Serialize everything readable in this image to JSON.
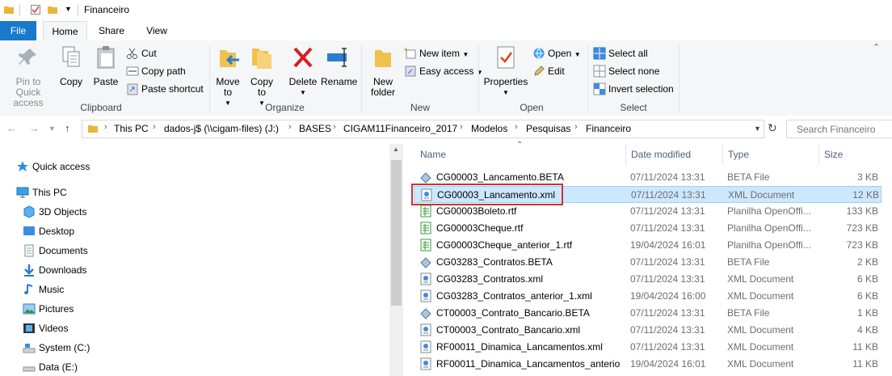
{
  "window": {
    "title": "Financeiro"
  },
  "tabs": [
    {
      "label": "File"
    },
    {
      "label": "Home"
    },
    {
      "label": "Share"
    },
    {
      "label": "View"
    }
  ],
  "ribbon": {
    "clipboard": {
      "label": "Clipboard",
      "pin": "Pin to Quick access",
      "copy": "Copy",
      "paste": "Paste",
      "cut": "Cut",
      "copy_path": "Copy path",
      "paste_shortcut": "Paste shortcut"
    },
    "organize": {
      "label": "Organize",
      "move_to": "Move to",
      "copy_to": "Copy to",
      "delete": "Delete",
      "rename": "Rename"
    },
    "new": {
      "label": "New",
      "new_folder": "New folder",
      "new_item": "New item",
      "easy_access": "Easy access"
    },
    "open": {
      "label": "Open",
      "properties": "Properties",
      "open": "Open",
      "edit": "Edit"
    },
    "select": {
      "label": "Select",
      "select_all": "Select all",
      "select_none": "Select none",
      "invert": "Invert selection"
    }
  },
  "address": {
    "crumbs": [
      "This PC",
      "dados-j$ (\\\\cigam-files) (J:)",
      "BASES",
      "CIGAM11Financeiro_2017",
      "Modelos",
      "Pesquisas",
      "Financeiro"
    ],
    "search_placeholder": "Search Financeiro"
  },
  "nav": {
    "quick_access": "Quick access",
    "this_pc": "This PC",
    "items": [
      "3D Objects",
      "Desktop",
      "Documents",
      "Downloads",
      "Music",
      "Pictures",
      "Videos",
      "System (C:)",
      "Data (E:)"
    ]
  },
  "columns": {
    "name": "Name",
    "date": "Date modified",
    "type": "Type",
    "size": "Size"
  },
  "files": [
    {
      "name": "CG00003_Lancamento.BETA",
      "date": "07/11/2024 13:31",
      "type": "BETA File",
      "size": "3 KB",
      "icon": "beta"
    },
    {
      "name": "CG00003_Lancamento.xml",
      "date": "07/11/2024 13:31",
      "type": "XML Document",
      "size": "12 KB",
      "icon": "xml"
    },
    {
      "name": "CG00003Boleto.rtf",
      "date": "07/11/2024 13:31",
      "type": "Planilha OpenOffi...",
      "size": "133 KB",
      "icon": "rtf"
    },
    {
      "name": "CG00003Cheque.rtf",
      "date": "07/11/2024 13:31",
      "type": "Planilha OpenOffi...",
      "size": "723 KB",
      "icon": "rtf"
    },
    {
      "name": "CG00003Cheque_anterior_1.rtf",
      "date": "19/04/2024 16:01",
      "type": "Planilha OpenOffi...",
      "size": "723 KB",
      "icon": "rtf"
    },
    {
      "name": "CG03283_Contratos.BETA",
      "date": "07/11/2024 13:31",
      "type": "BETA File",
      "size": "2 KB",
      "icon": "beta"
    },
    {
      "name": "CG03283_Contratos.xml",
      "date": "07/11/2024 13:31",
      "type": "XML Document",
      "size": "6 KB",
      "icon": "xml"
    },
    {
      "name": "CG03283_Contratos_anterior_1.xml",
      "date": "19/04/2024 16:00",
      "type": "XML Document",
      "size": "6 KB",
      "icon": "xml"
    },
    {
      "name": "CT00003_Contrato_Bancario.BETA",
      "date": "07/11/2024 13:31",
      "type": "BETA File",
      "size": "1 KB",
      "icon": "beta"
    },
    {
      "name": "CT00003_Contrato_Bancario.xml",
      "date": "07/11/2024 13:31",
      "type": "XML Document",
      "size": "4 KB",
      "icon": "xml"
    },
    {
      "name": "RF00011_Dinamica_Lancamentos.xml",
      "date": "07/11/2024 13:31",
      "type": "XML Document",
      "size": "11 KB",
      "icon": "xml"
    },
    {
      "name": "RF00011_Dinamica_Lancamentos_anterio...",
      "date": "19/04/2024 16:01",
      "type": "XML Document",
      "size": "11 KB",
      "icon": "xml"
    }
  ],
  "selected_index": 1,
  "colors": {
    "accent": "#1979ca",
    "selection": "#cce8ff",
    "highlight": "#d0312d"
  }
}
